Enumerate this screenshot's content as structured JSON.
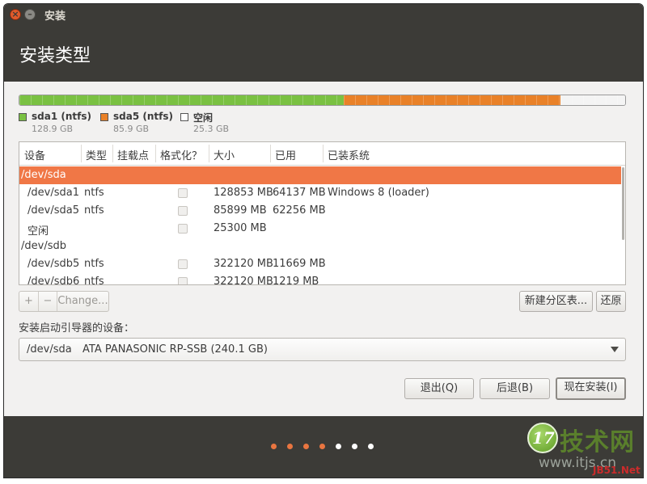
{
  "window": {
    "title": "安装"
  },
  "header": {
    "title": "安装类型"
  },
  "partition_bar": {
    "segments": [
      {
        "name": "sda1",
        "color": "#7ac142",
        "fraction": 0.536
      },
      {
        "name": "sda5",
        "color": "#e98128",
        "fraction": 0.357
      },
      {
        "name": "free",
        "color": "#f4f4f4",
        "fraction": 0.107
      }
    ]
  },
  "legend": [
    {
      "label": "sda1 (ntfs)",
      "size": "128.9 GB",
      "color": "#7ac142"
    },
    {
      "label": "sda5 (ntfs)",
      "size": "85.9 GB",
      "color": "#e98128"
    },
    {
      "label": "空闲",
      "size": "25.3 GB",
      "color": "#ffffff"
    }
  ],
  "table": {
    "columns": [
      "设备",
      "类型",
      "挂载点",
      "格式化？",
      "大小",
      "已用",
      "已装系统"
    ],
    "rows": [
      {
        "device": "/dev/sda",
        "type": "",
        "mount": "",
        "size": "",
        "used": "",
        "system": "",
        "selected": true
      },
      {
        "device": "/dev/sda1",
        "type": "ntfs",
        "mount": "",
        "size": "128853 MB",
        "used": "64137 MB",
        "system": "Windows 8 (loader)"
      },
      {
        "device": "/dev/sda5",
        "type": "ntfs",
        "mount": "",
        "size": "85899 MB",
        "used": "62256 MB",
        "system": ""
      },
      {
        "device": "空闲",
        "type": "",
        "mount": "",
        "size": "25300 MB",
        "used": "",
        "system": ""
      },
      {
        "device": "/dev/sdb",
        "type": "",
        "mount": "",
        "size": "",
        "used": "",
        "system": ""
      },
      {
        "device": "/dev/sdb5",
        "type": "ntfs",
        "mount": "",
        "size": "322120 MB",
        "used": "11669 MB",
        "system": ""
      },
      {
        "device": "/dev/sdb6",
        "type": "ntfs",
        "mount": "",
        "size": "322120 MB",
        "used": "1219 MB",
        "system": ""
      }
    ]
  },
  "toolbar": {
    "add": "+",
    "remove": "−",
    "change": "Change...",
    "new_table": "新建分区表...",
    "revert": "还原"
  },
  "bootloader": {
    "label": "安装启动引导器的设备：",
    "device": "/dev/sda",
    "description": "ATA PANASONIC RP-SSB (240.1 GB)"
  },
  "actions": {
    "quit": "退出(Q)",
    "back": "后退(B)",
    "install": "现在安装(I)"
  },
  "progress": {
    "steps_total": 7,
    "steps_done": 4,
    "active_color": "#e97540",
    "inactive_color": "#ffffff"
  },
  "watermark": {
    "badge": "17",
    "brand": "技术网",
    "url": "www.itjs.cn",
    "jb": "JB51.Net"
  }
}
